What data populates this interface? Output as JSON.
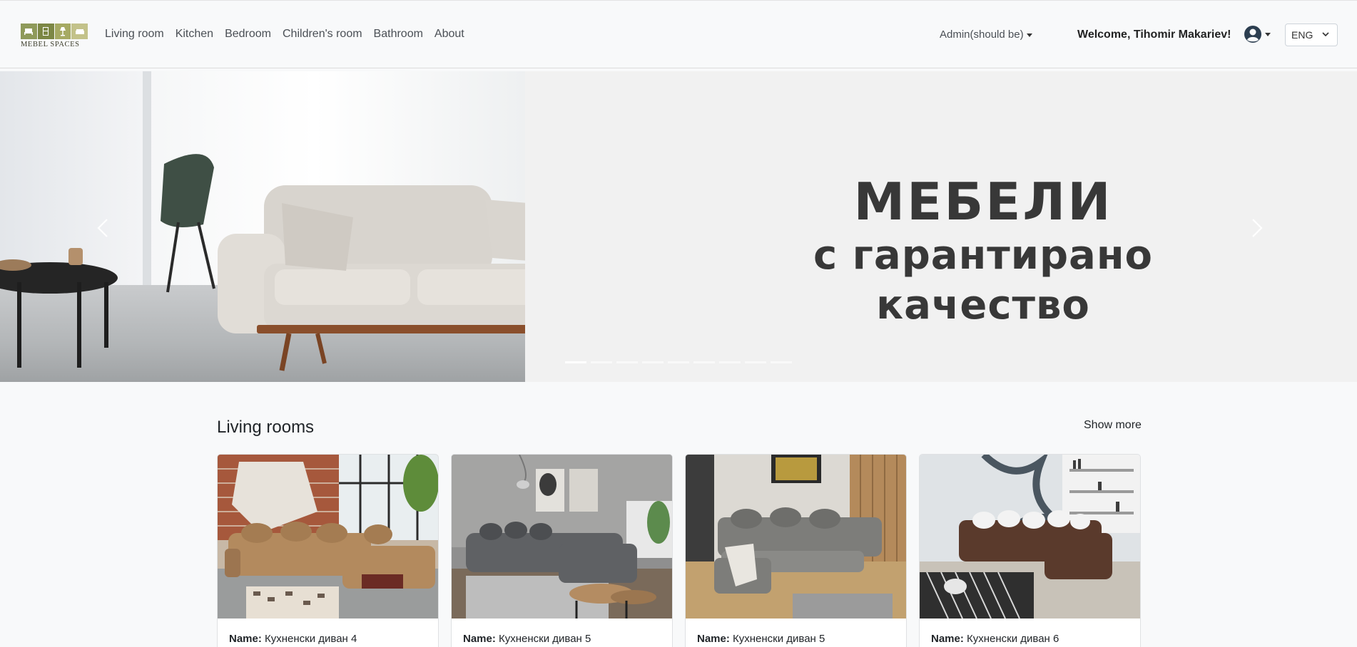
{
  "header": {
    "logo_text": "MEBEL SPACES",
    "nav": [
      "Living room",
      "Kitchen",
      "Bedroom",
      "Children's room",
      "Bathroom",
      "About"
    ],
    "admin_label": "Admin(should be)",
    "welcome": "Welcome, Tihomir Makariev!",
    "user_icon": "user-circle-icon",
    "language": "ENG"
  },
  "hero": {
    "line1": "МЕБЕЛИ",
    "line2": "с гарантирано качество",
    "slide_count": 9,
    "active_slide": 1
  },
  "section": {
    "title": "Living rooms",
    "show_more": "Show more"
  },
  "cards": [
    {
      "name_label": "Name:",
      "name": "Кухненски диван 4",
      "sofa_color": "#b38a5e",
      "scene": "brick"
    },
    {
      "name_label": "Name:",
      "name": "Кухненски диван 5",
      "sofa_color": "#5f6164",
      "scene": "grey"
    },
    {
      "name_label": "Name:",
      "name": "Кухненски диван 5",
      "sofa_color": "#7d7d7a",
      "scene": "wood"
    },
    {
      "name_label": "Name:",
      "name": "Кухненски диван 6",
      "sofa_color": "#5a3a2c",
      "scene": "marble"
    }
  ],
  "colors": {
    "navbar_bg": "#f8f9fa",
    "hero_text": "#383838",
    "logo_green": "#8f9a5a"
  }
}
